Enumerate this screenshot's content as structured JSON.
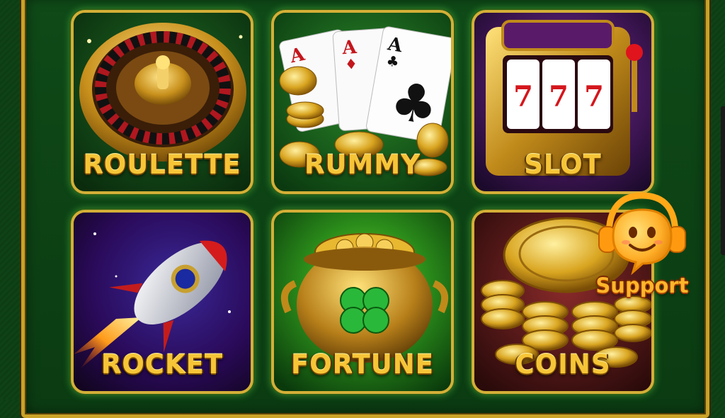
{
  "games": [
    {
      "id": "roulette",
      "label": "ROULETTE"
    },
    {
      "id": "rummy",
      "label": "RUMMY"
    },
    {
      "id": "slot",
      "label": "SLOT"
    },
    {
      "id": "rocket",
      "label": "ROCKET"
    },
    {
      "id": "fortune",
      "label": "FORTUNE"
    },
    {
      "id": "coins",
      "label": "COINS"
    }
  ],
  "support": {
    "label": "Support",
    "icon": "headset-smiley-icon"
  },
  "colors": {
    "gold": "#f6c537",
    "frame": "#c9a227",
    "felt": "#0f4417",
    "glow": "#7dff5a"
  }
}
